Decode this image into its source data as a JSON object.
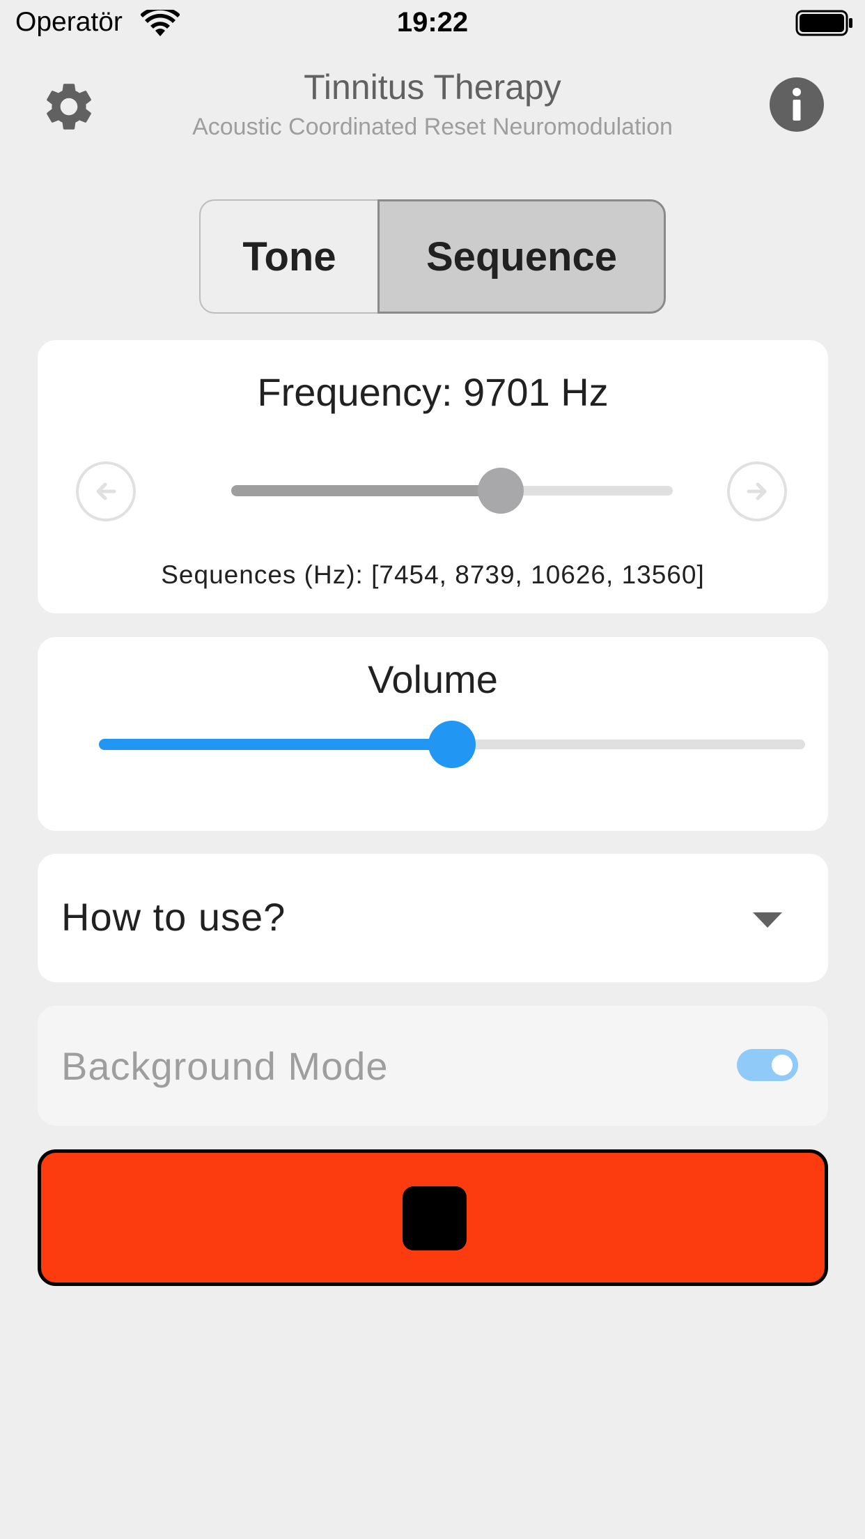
{
  "status_bar": {
    "carrier": "Operatör",
    "time": "19:22",
    "icons": [
      "wifi-icon",
      "battery-icon"
    ]
  },
  "app_bar": {
    "title": "Tinnitus Therapy",
    "subtitle": "Acoustic Coordinated Reset Neuromodulation",
    "left_icon": "gear-icon",
    "right_icon": "info-icon"
  },
  "mode_toggle": {
    "options": [
      "Tone",
      "Sequence"
    ],
    "selected": "Sequence"
  },
  "frequency": {
    "label": "Frequency: 9701 Hz",
    "slider_fraction": 0.61,
    "prev_icon": "arrow-left-icon",
    "next_icon": "arrow-right-icon",
    "sequences_label": "Sequences (Hz): [7454, 8739, 10626, 13560]"
  },
  "volume": {
    "label": "Volume",
    "slider_fraction": 0.5
  },
  "how_to_use": {
    "label": "How to use?",
    "icon": "dropdown-arrow-icon"
  },
  "background_mode": {
    "label": "Background Mode",
    "enabled": true
  },
  "stop_button": {
    "icon": "stop-icon"
  },
  "colors": {
    "accent": "#2196f3",
    "stop_button": "#fc3b0e",
    "background": "#eeeeee"
  }
}
